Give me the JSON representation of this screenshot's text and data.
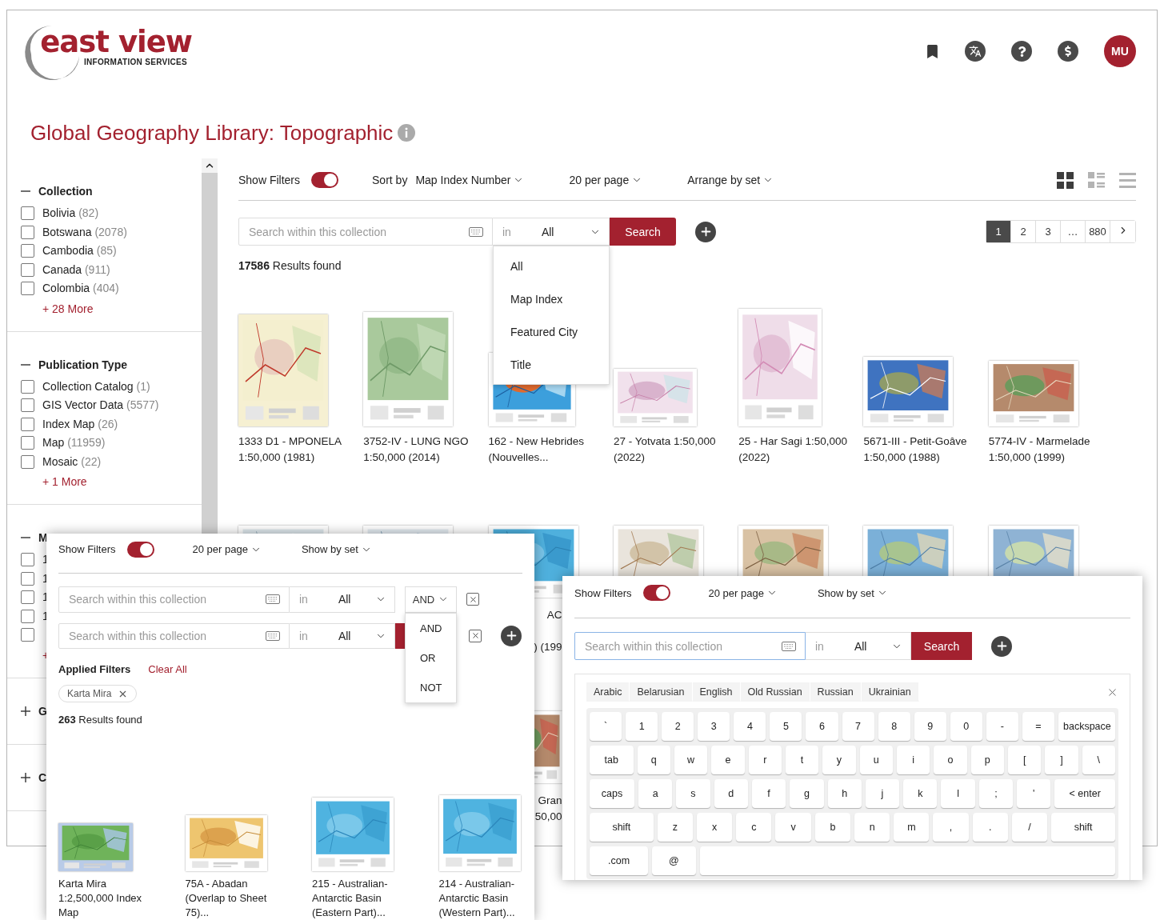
{
  "header": {
    "logo": {
      "name": "east view",
      "tagline": "INFORMATION SERVICES"
    },
    "avatar": "MU"
  },
  "title": "Global Geography Library: Topographic",
  "sidebar": {
    "sections": [
      {
        "title": "Collection",
        "expanded": true,
        "items": [
          {
            "label": "Bolivia",
            "count": "(82)",
            "checked": false
          },
          {
            "label": "Botswana",
            "count": "(2078)",
            "checked": false
          },
          {
            "label": "Cambodia",
            "count": "(85)",
            "checked": false
          },
          {
            "label": "Canada",
            "count": "(911)",
            "checked": false
          },
          {
            "label": "Colombia",
            "count": "(404)",
            "checked": false
          }
        ],
        "more": "+ 28 More"
      },
      {
        "title": "Publication Type",
        "expanded": true,
        "items": [
          {
            "label": "Collection Catalog",
            "count": "(1)",
            "checked": false
          },
          {
            "label": "GIS Vector Data",
            "count": "(5577)",
            "checked": false
          },
          {
            "label": "Index Map",
            "count": "(26)",
            "checked": false
          },
          {
            "label": "Map",
            "count": "(11959)",
            "checked": false
          },
          {
            "label": "Mosaic",
            "count": "(22)",
            "checked": false
          }
        ],
        "more": "+ 1 More"
      },
      {
        "title": "M",
        "expanded": true,
        "items": [
          {
            "label": "1",
            "checked": false
          },
          {
            "label": "1",
            "checked": false
          },
          {
            "label": "1",
            "checked": false
          },
          {
            "label": "1",
            "checked": false
          },
          {
            "checked": false
          }
        ],
        "more": "+"
      },
      {
        "title": "G",
        "expanded": false
      },
      {
        "title": "C",
        "expanded": false
      }
    ]
  },
  "main": {
    "toolbar": {
      "show_filters_label": "Show Filters",
      "show_filters_on": true,
      "sort_label": "Sort by",
      "sort_value": "Map Index Number",
      "per_page": "20 per page",
      "arrange": "Arrange by set",
      "views": [
        {
          "kind": "grid",
          "selected": true
        },
        {
          "kind": "list",
          "selected": false
        },
        {
          "kind": "rows",
          "selected": false
        }
      ]
    },
    "search": {
      "placeholder": "Search within this collection",
      "in_label": "in",
      "field_value": "All",
      "button": "Search",
      "field_menu": [
        {
          "label": "All",
          "selected": false
        },
        {
          "label": "Map Index",
          "selected": false
        },
        {
          "label": "Featured City",
          "selected": false
        },
        {
          "label": "Title",
          "selected": false
        }
      ]
    },
    "pagination": [
      {
        "label": "1",
        "selected": true
      },
      {
        "label": "2",
        "selected": false
      },
      {
        "label": "3",
        "selected": false
      },
      {
        "label": "…",
        "selected": false
      },
      {
        "label": "880",
        "selected": false
      }
    ],
    "results_count": "17586",
    "results_label": "Results found",
    "cards": [
      {
        "caption": "1333 D1 - MPONELA 1:50,000 (1981)"
      },
      {
        "caption": "3752-IV - LUNG NGO 1:50,000 (2014)"
      },
      {
        "caption": "162 - New Hebrides (Nouvelles..."
      },
      {
        "caption": "27 - Yotvata 1:50,000 (2022)"
      },
      {
        "caption": "25 - Har Sagi 1:50,000 (2022)"
      },
      {
        "caption": "5671-III - Petit-Goâve 1:50,000 (1988)"
      },
      {
        "caption": "5774-IV - Marmelade 1:50,000 (1999)"
      }
    ],
    "covered_captions": [
      [
        "AC",
        ") (199"
      ],
      [
        "Gran",
        "50,00"
      ]
    ]
  },
  "advanced_search_panel": {
    "toolbar": {
      "show_filters_label": "Show Filters",
      "show_filters_on": true,
      "per_page": "20 per page",
      "show_by": "Show by set"
    },
    "queries": [
      {
        "placeholder": "Search within this collection",
        "in_label": "in",
        "field_value": "All",
        "operator": "AND",
        "operator_menu": [
          {
            "label": "AND",
            "selected": false
          },
          {
            "label": "OR",
            "selected": false
          },
          {
            "label": "NOT",
            "selected": false
          }
        ]
      },
      {
        "placeholder": "Search within this collection",
        "in_label": "in",
        "field_value": "All"
      }
    ],
    "applied_filters_label": "Applied Filters",
    "clear_all": "Clear All",
    "chips": [
      "Karta Mira"
    ],
    "results_count": "263",
    "results_label": "Results found",
    "cards": [
      {
        "caption": "Karta Mira 1:2,500,000 Index Map"
      },
      {
        "caption": "75A - Abadan (Overlap to Sheet 75)..."
      },
      {
        "caption": "215 - Australian-Antarctic Basin (Eastern Part)..."
      },
      {
        "caption": "214 - Australian-Antarctic Basin (Western Part)..."
      }
    ]
  },
  "keyboard_panel": {
    "toolbar": {
      "show_filters_label": "Show Filters",
      "show_filters_on": true,
      "per_page": "20 per page",
      "show_by": "Show by set"
    },
    "search": {
      "placeholder": "Search within this collection",
      "focused": true,
      "in_label": "in",
      "field_value": "All",
      "button": "Search"
    },
    "languages": [
      {
        "label": "Arabic",
        "selected": false
      },
      {
        "label": "Belarusian",
        "selected": false
      },
      {
        "label": "English",
        "selected": false
      },
      {
        "label": "Old Russian",
        "selected": false
      },
      {
        "label": "Russian",
        "selected": false
      },
      {
        "label": "Ukrainian",
        "selected": false
      }
    ],
    "keys": [
      [
        "`",
        "1",
        "2",
        "3",
        "4",
        "5",
        "6",
        "7",
        "8",
        "9",
        "0",
        "-",
        "=",
        "backspace"
      ],
      [
        "tab",
        "q",
        "w",
        "e",
        "r",
        "t",
        "y",
        "u",
        "i",
        "o",
        "p",
        "[",
        "]",
        "\\"
      ],
      [
        "caps",
        "a",
        "s",
        "d",
        "f",
        "g",
        "h",
        "j",
        "k",
        "l",
        ";",
        "'",
        "< enter"
      ],
      [
        "shift",
        "z",
        "x",
        "c",
        "v",
        "b",
        "n",
        "m",
        ",",
        ".",
        "/",
        "shift"
      ],
      [
        ".com",
        "@"
      ]
    ]
  }
}
